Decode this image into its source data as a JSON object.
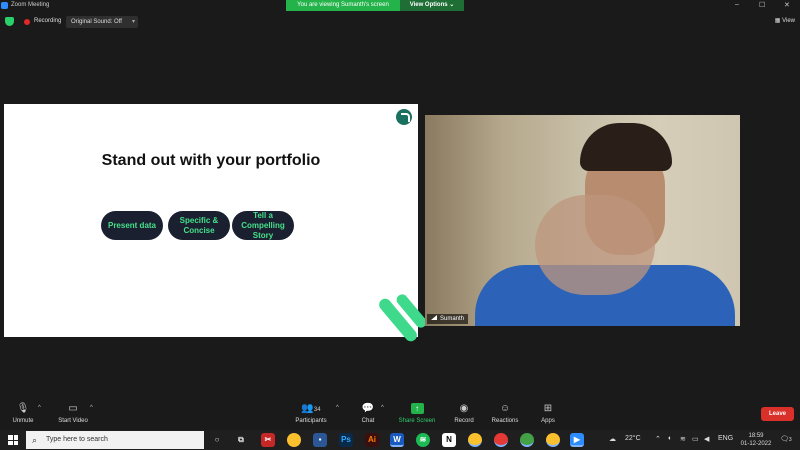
{
  "window": {
    "title": "Zoom Meeting",
    "viewing_banner": "You are viewing Sumanth's screen",
    "view_options": "View Options",
    "view_options_caret": "⌄",
    "controls": {
      "minimize": "–",
      "maximize": "☐",
      "close": "✕"
    }
  },
  "status": {
    "recording_label": "Recording",
    "original_sound": "Original Sound: Off",
    "original_sound_caret": "▾",
    "view_label": "View"
  },
  "slide": {
    "title": "Stand out with your portfolio",
    "pills": [
      "Present data",
      "Specific & Concise",
      "Tell a Compelling Story"
    ]
  },
  "video": {
    "participant_name": "Sumanth"
  },
  "toolbar": {
    "unmute": "Unmute",
    "start_video": "Start Video",
    "participants": "Participants",
    "participants_count": "34",
    "chat": "Chat",
    "share_screen": "Share Screen",
    "record": "Record",
    "reactions": "Reactions",
    "apps": "Apps",
    "leave": "Leave",
    "caret": "^"
  },
  "taskbar": {
    "search_placeholder": "Type here to search",
    "weather": "22°C",
    "language": "ENG",
    "time": "18:59",
    "date": "01-12-2022",
    "notification_count": "3"
  },
  "colors": {
    "accent_green": "#24b24a",
    "slide_pill_bg": "#1b2030",
    "slide_pill_text": "#45e089",
    "leave_red": "#d9302a"
  }
}
